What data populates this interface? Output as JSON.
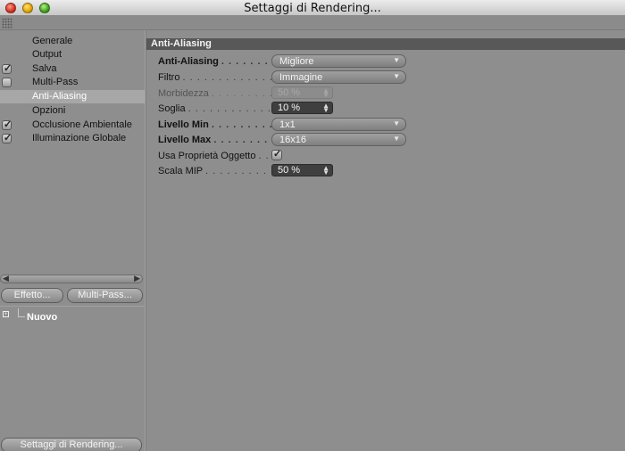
{
  "window": {
    "title": "Settaggi di Rendering..."
  },
  "sidebar": {
    "items": [
      {
        "label": "Generale",
        "checkbox": null
      },
      {
        "label": "Output",
        "checkbox": null
      },
      {
        "label": "Salva",
        "checkbox": true
      },
      {
        "label": "Multi-Pass",
        "checkbox": false
      },
      {
        "label": "Anti-Aliasing",
        "checkbox": null,
        "selected": true
      },
      {
        "label": "Opzioni",
        "checkbox": null
      },
      {
        "label": "Occlusione Ambientale",
        "checkbox": true
      },
      {
        "label": "Illuminazione Globale",
        "checkbox": true
      }
    ],
    "effect_button": "Effetto...",
    "multipass_button": "Multi-Pass...",
    "tree_item": "Nuovo",
    "bottom_button": "Settaggi di Rendering..."
  },
  "panel": {
    "section_title": "Anti-Aliasing",
    "rows": {
      "antialiasing": {
        "label": "Anti-Aliasing",
        "value": "Migliore"
      },
      "filtro": {
        "label": "Filtro",
        "value": "Immagine"
      },
      "morbidezza": {
        "label": "Morbidezza",
        "value": "50 %"
      },
      "soglia": {
        "label": "Soglia",
        "value": "10 %"
      },
      "livello_min": {
        "label": "Livello Min",
        "value": "1x1"
      },
      "livello_max": {
        "label": "Livello Max",
        "value": "16x16"
      },
      "usa_proprieta": {
        "label": "Usa Proprietà Oggetto",
        "checked": true
      },
      "scala_mip": {
        "label": "Scala MIP",
        "value": "50 %"
      }
    },
    "dots": {
      "antialiasing": ". . . . . . . .",
      "filtro": ". . . . . . . . . . . . . . . . . .",
      "morbidezza": ". . . . . . . . . . . .",
      "soglia": ". . . . . . . . . . . . . . . . .",
      "livello_min": ". . . . . . . . . . .",
      "livello_max": ". . . . . . . . . .",
      "usa_proprieta": ". .",
      "scala_mip": ". . . . . . . . . . . . . ."
    }
  },
  "icons": {
    "check": "✓",
    "dropdown_arrow": "▼",
    "spin_arrows": "▲▼"
  }
}
